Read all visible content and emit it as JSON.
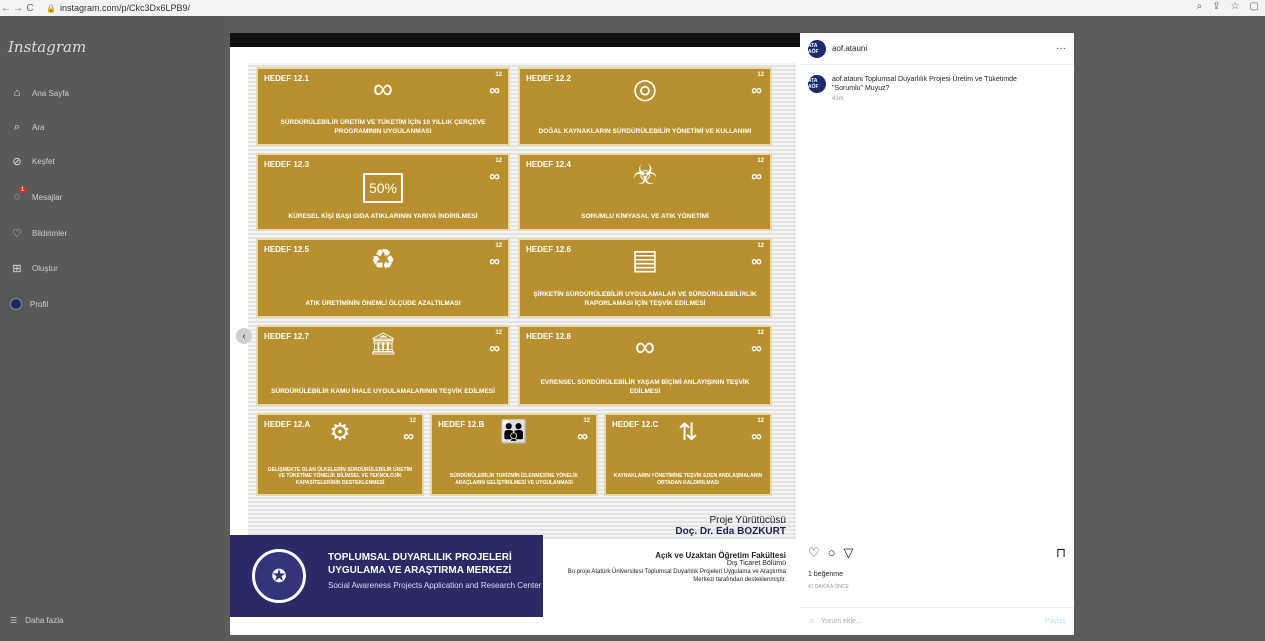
{
  "browser": {
    "url": "instagram.com/p/Ckc3Dx6LPB9/"
  },
  "sidebar": {
    "logo": "Instagram",
    "items": [
      {
        "label": "Ana Sayfa",
        "icon": "home-icon"
      },
      {
        "label": "Ara",
        "icon": "search-icon"
      },
      {
        "label": "Keşfet",
        "icon": "compass-icon"
      },
      {
        "label": "Mesajlar",
        "icon": "messenger-icon",
        "badge": "1"
      },
      {
        "label": "Bildirimler",
        "icon": "heart-icon"
      },
      {
        "label": "Oluştur",
        "icon": "plus-square-icon"
      },
      {
        "label": "Profil",
        "icon": "profile-avatar"
      }
    ],
    "more_label": "Daha fazla"
  },
  "poster": {
    "cards": [
      {
        "id": "12.1",
        "title": "HEDEF 12.1",
        "caption": "SÜRDÜRÜLEBİLİR ÜRETİM VE TÜKETİM İÇİN 10 YILLIK ÇERÇEVE PROGRAMININ UYGULANMASI",
        "icon": "∞"
      },
      {
        "id": "12.2",
        "title": "HEDEF 12.2",
        "caption": "DOĞAL KAYNAKLARIN SÜRDÜRÜLEBİLİR YÖNETİMİ VE KULLANIMI",
        "icon": "◎"
      },
      {
        "id": "12.3",
        "title": "HEDEF 12.3",
        "caption": "KÜRESEL KİŞİ BAŞI GIDA ATIKLARININ YARIYA İNDİRİLMESİ",
        "icon": "50%"
      },
      {
        "id": "12.4",
        "title": "HEDEF 12.4",
        "caption": "SORUMLU KİMYASAL VE ATIK YÖNETİMİ",
        "icon": "☣"
      },
      {
        "id": "12.5",
        "title": "HEDEF 12.5",
        "caption": "ATIK ÜRETİMİNİN ÖNEMLİ ÖLÇÜDE AZALTILMASI",
        "icon": "♻"
      },
      {
        "id": "12.6",
        "title": "HEDEF 12.6",
        "caption": "ŞİRKETİN SÜRDÜRÜLEBİLİR UYGULAMALAR VE SÜRDÜRÜLEBİLİRLİK RAPORLAMASI İÇİN TEŞVİK EDİLMESİ",
        "icon": "▤"
      },
      {
        "id": "12.7",
        "title": "HEDEF 12.7",
        "caption": "SÜRDÜRÜLEBİLİR KAMU İHALE UYGULAMALARININ TEŞVİK EDİLMESİ",
        "icon": "🏛"
      },
      {
        "id": "12.8",
        "title": "HEDEF 12.8",
        "caption": "EVRENSEL SÜRDÜRÜLEBİLİR YAŞAM BİÇİMİ ANLAYIŞININ TEŞVİK EDİLMESİ",
        "icon": "∞"
      },
      {
        "id": "12.A",
        "title": "HEDEF 12.A",
        "caption": "GELİŞMEKTE OLAN ÜLKELERİN SÜRDÜRÜLEBİLİR ÜRETİM VE TÜKETİME YÖNELİK BİLİMSEL VE TEKNOLOJİK KAPASİTELERİNİN DESTEKLENMESİ",
        "icon": "⚙"
      },
      {
        "id": "12.B",
        "title": "HEDEF 12.B",
        "caption": "SÜRDÜRÜLEBİLİR TURİZMİN İZLENMESİNE YÖNELİK ARAÇLARIN GELİŞTİRİLMESİ VE UYGULANMASI",
        "icon": "👪"
      },
      {
        "id": "12.C",
        "title": "HEDEF 12.C",
        "caption": "KAYNAKLARIN YÖNETİMİNE TEŞVİK EDEN ANDLAŞMALARIN ORTADAN KALDIRILMASI",
        "icon": "⇅"
      }
    ],
    "card_tag": "12",
    "card_inf": "∞",
    "banner_title": "TOPLUMSAL DUYARLILIK PROJELERİ UYGULAMA VE ARAŞTIRMA MERKEZİ",
    "banner_subtitle": "Social Awareness Projects Application and Research Center",
    "coordinator_label": "Proje Yürütücüsü",
    "coordinator_name": "Doç. Dr. Eda BOZKURT",
    "faculty": "Açık ve Uzaktan Öğretim Fakültesi",
    "department": "Dış Ticaret Bölümü",
    "support_note": "Bu proje Atatürk Üniversitesi Toplumsal Duyarlılık Projeleri Uygulama ve Araştırma Merkezi tarafından desteklenmiştir."
  },
  "panel": {
    "username": "aof.atauni",
    "avatar_text": "ATA AÖF",
    "caption_user": "aof.atauni",
    "caption_text": "Toplumsal Duyarlılık Projesi Üretim ve Tüketimde \"Sorumlu\" Muyuz?",
    "caption_time": "43m",
    "likes": "1 beğenme",
    "date": "41 DAKİKA ÖNCE",
    "comment_placeholder": "Yorum ekle...",
    "share_label": "Paylaş"
  }
}
